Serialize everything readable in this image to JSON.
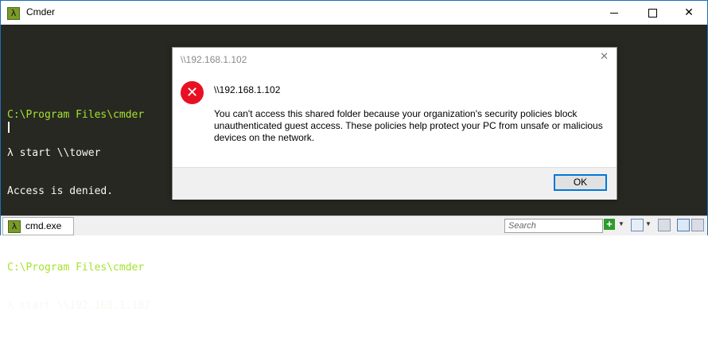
{
  "window": {
    "title": "Cmder",
    "icon": "lambda-icon"
  },
  "console": {
    "lines": [
      {
        "text": "",
        "kind": "plain"
      },
      {
        "text": "C:\\Program Files\\cmder",
        "kind": "path"
      },
      {
        "text": "λ start \\\\tower",
        "kind": "plain"
      },
      {
        "text": "Access is denied.",
        "kind": "plain"
      },
      {
        "text": "",
        "kind": "plain"
      },
      {
        "text": "C:\\Program Files\\cmder",
        "kind": "path"
      },
      {
        "text": "λ start \\\\192.168.1.102",
        "kind": "plain"
      }
    ]
  },
  "statusbar": {
    "tab_label": "cmd.exe",
    "search_placeholder": "Search"
  },
  "dialog": {
    "title": "\\\\192.168.1.102",
    "heading": "\\\\192.168.1.102",
    "message": "You can't access this shared folder because your organization's security policies block unauthenticated guest access. These policies help protect your PC from unsafe or malicious devices on the network.",
    "ok_label": "OK"
  },
  "colors": {
    "console_bg": "#272822",
    "path_green": "#a6e22e",
    "error_red": "#e81123",
    "focus_blue": "#0078d7"
  }
}
